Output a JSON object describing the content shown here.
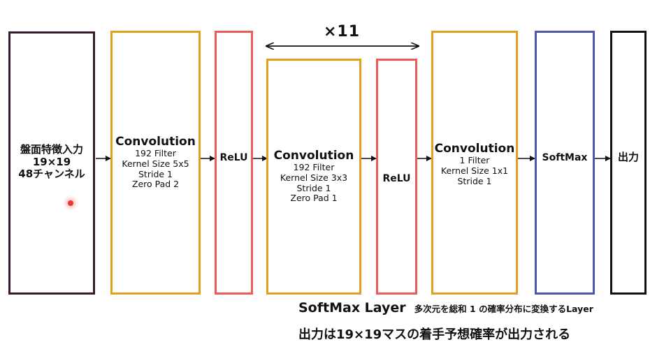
{
  "diagram": {
    "repeat_label": "×11",
    "blocks": {
      "input": {
        "lines": [
          "盤面特徴入力",
          "19×19",
          "48チャンネル"
        ],
        "color": "#3a1a2e"
      },
      "conv1": {
        "title": "Convolution",
        "lines": [
          "192 Filter",
          "Kernel Size 5x5",
          "Stride 1",
          "Zero Pad 2"
        ],
        "color": "#e0a21c"
      },
      "relu1": {
        "title": "ReLU",
        "color": "#ef5a57"
      },
      "conv2": {
        "title": "Convolution",
        "lines": [
          "192 Filter",
          "Kernel Size 3x3",
          "Stride 1",
          "Zero Pad 1"
        ],
        "color": "#e0a21c"
      },
      "relu2": {
        "title": "ReLU",
        "color": "#ef5a57"
      },
      "conv3": {
        "title": "Convolution",
        "lines": [
          "1 Filter",
          "Kernel Size 1x1",
          "Stride 1"
        ],
        "color": "#e0a21c"
      },
      "softmax": {
        "title": "SoftMax",
        "color": "#4a5aa8"
      },
      "output": {
        "title": "出力",
        "color": "#111111"
      }
    },
    "caption": {
      "title": "SoftMax Layer",
      "desc": "多次元を総和 1 の確率分布に変換するLayer",
      "line2": "出力は19×19マスの着手予想確率が出力される"
    }
  }
}
